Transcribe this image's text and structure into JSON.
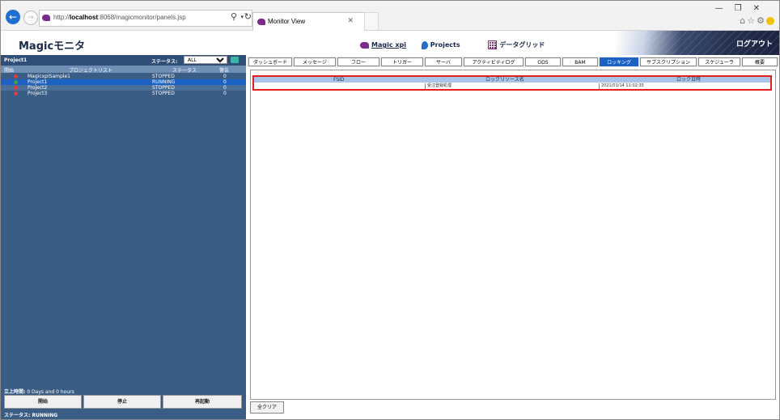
{
  "browser": {
    "url_prefix": "http://",
    "url_host": "localhost",
    "url_rest": ":8068/magicmonitor/panels.jsp",
    "tab_title": "Monitor View"
  },
  "app": {
    "title": "Magicモニタ",
    "nav": [
      {
        "label": "Magic xpi",
        "icon": "magic-icon"
      },
      {
        "label": "Projects",
        "icon": "projects-icon"
      },
      {
        "label": "データグリッド",
        "icon": "datagrid-icon"
      }
    ],
    "logout": "ログアウト"
  },
  "left": {
    "project_name": "Project1",
    "status_label": "ステータス:",
    "status_value": "ALL",
    "columns": {
      "start": "開始",
      "project_list": "プロジェクトリスト",
      "status": "ステータス",
      "warnings": "警告"
    },
    "rows": [
      {
        "name": "MagicxpiSample1",
        "status": "STOPPED",
        "warnings": "0",
        "color": "#e53935"
      },
      {
        "name": "Project1",
        "status": "RUNNING",
        "warnings": "0",
        "color": "#43a047"
      },
      {
        "name": "Project2",
        "status": "STOPPED",
        "warnings": "0",
        "color": "#e53935"
      },
      {
        "name": "Project3",
        "status": "STOPPED",
        "warnings": "0",
        "color": "#e53935"
      }
    ],
    "uptime_label": "立上時間:",
    "uptime_value": "0 Days and 0 hours",
    "buttons": {
      "start": "開始",
      "stop": "停止",
      "restart": "再起動"
    },
    "footer_status": "ステータス: RUNNING"
  },
  "tabs": [
    "ダッシュボード",
    "メッセージ",
    "フロー",
    "トリガー",
    "サーバ",
    "アクティビティログ",
    "ODS",
    "BAM",
    "ロッキング",
    "サブスクリプション",
    "スケジューラ",
    "概要"
  ],
  "active_tab": "ロッキング",
  "locking": {
    "columns": {
      "fsid": "FSID",
      "resource": "ロックリソース名",
      "date": "ロック日時"
    },
    "rows": [
      {
        "fsid": "",
        "resource": "受注登録処理",
        "date": "2021/01/14 11:02:35"
      }
    ]
  },
  "clear_all": "全クリア"
}
